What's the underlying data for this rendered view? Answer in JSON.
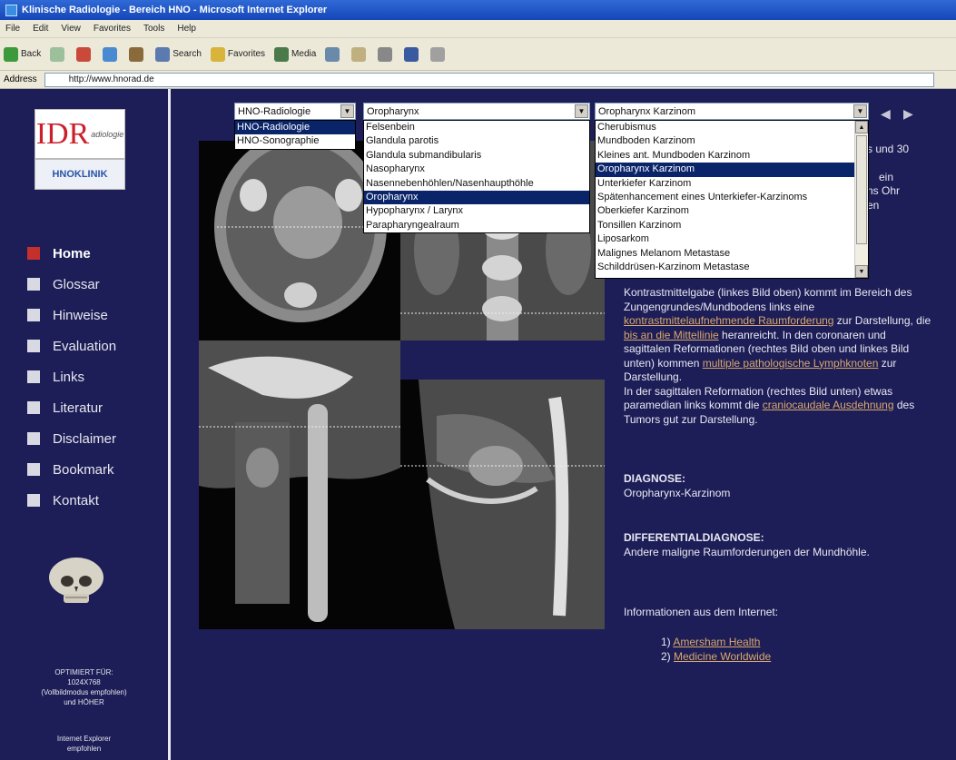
{
  "window": {
    "title": "Klinische Radiologie - Bereich HNO - Microsoft Internet Explorer"
  },
  "menu": [
    "File",
    "Edit",
    "View",
    "Favorites",
    "Tools",
    "Help"
  ],
  "toolbar": {
    "back": "Back",
    "search": "Search",
    "favorites": "Favorites",
    "media": "Media"
  },
  "address": {
    "label": "Address",
    "url": "http://www.hnorad.de"
  },
  "logos": {
    "idr_letters": "IDR",
    "idr_sub": "adiologie",
    "hno": "HNOKLINIK"
  },
  "nav": [
    "Home",
    "Glossar",
    "Hinweise",
    "Evaluation",
    "Links",
    "Literatur",
    "Disclaimer",
    "Bookmark",
    "Kontakt"
  ],
  "side_notes": {
    "optimized": [
      "OPTIMIERT FÜR:",
      "1024X768",
      "(Vollbildmodus empfohlen)",
      "und HÖHER"
    ],
    "browser": [
      "Internet Explorer",
      "empfohlen"
    ]
  },
  "dropdowns": {
    "category": {
      "value": "HNO-Radiologie",
      "options": [
        "HNO-Radiologie",
        "HNO-Sonographie"
      ],
      "selected": 0
    },
    "region": {
      "value": "Oropharynx",
      "options": [
        "Felsenbein",
        "Glandula parotis",
        "Glandula submandibularis",
        "Nasopharynx",
        "Nasennebenhöhlen/Nasenhaupthöhle",
        "Oropharynx",
        "Hypopharynx / Larynx",
        "Parapharyngealraum"
      ],
      "selected": 5
    },
    "case": {
      "value": "Oropharynx Karzinom",
      "options": [
        "Cherubismus",
        "Mundboden Karzinom",
        "Kleines ant. Mundboden Karzinom",
        "Oropharynx Karzinom",
        "Unterkiefer Karzinom",
        "Spätenhancement eines Unterkiefer-Karzinoms",
        "Oberkiefer Karzinom",
        "Tonsillen Karzinom",
        "Liposarkom",
        "Malignes Melanom Metastase",
        "Schilddrüsen-Karzinom Metastase"
      ],
      "selected": 3
    }
  },
  "partial_text": [
    "s und 30",
    "ein",
    "ns Ohr",
    "en"
  ],
  "findings": {
    "p1_a": "Kontrastmittelgabe (linkes Bild oben) kommt im Bereich des Zungengrundes/Mundbodens links eine ",
    "p1_link": "kontrastmittelaufnehmende Raumforderung",
    "p1_b": " zur Darstellung, die ",
    "p1_link2": "bis an die Mittellinie",
    "p1_c": " heranreicht. In den coronaren und sagittalen Reformationen (rechtes Bild oben und linkes Bild unten) kommen ",
    "p1_link3": "multiple pathologische Lymphknoten",
    "p1_d": " zur Darstellung.",
    "p2_a": "In der sagittalen Reformation (rechtes Bild unten) etwas paramedian links kommt die ",
    "p2_link": "craniocaudale Ausdehnung",
    "p2_b": " des Tumors gut zur Darstellung."
  },
  "diagnosis": {
    "heading": "DIAGNOSE:",
    "text": "Oropharynx-Karzinom"
  },
  "differential": {
    "heading": "DIFFERENTIALDIAGNOSE:",
    "text": "Andere maligne Raumforderungen der Mundhöhle."
  },
  "internet": {
    "heading": "Informationen aus dem Internet:",
    "links": [
      {
        "num": "1)",
        "label": "Amersham Health"
      },
      {
        "num": "2)",
        "label": "Medicine Worldwide"
      }
    ]
  },
  "colors": {
    "page_bg": "#1d1e57",
    "link": "#d9a86c",
    "active_bullet": "#c4302b",
    "selection": "#0a246a"
  }
}
